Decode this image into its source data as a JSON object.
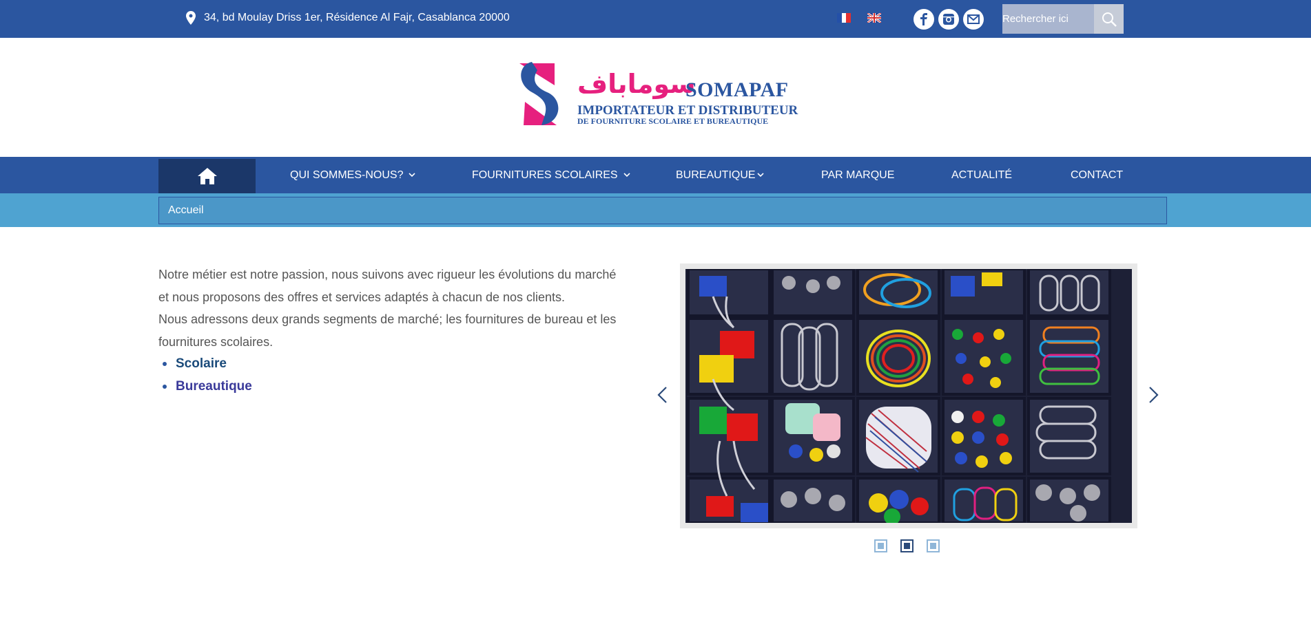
{
  "topbar": {
    "address": "34, bd Moulay Driss 1er, Résidence Al Fajr, Casablanca 20000",
    "search_placeholder": "Rechercher ici",
    "languages": [
      "fr",
      "en"
    ],
    "socials": [
      "facebook-icon",
      "instagram-icon",
      "email-icon"
    ],
    "bg_color": "#2b56a0"
  },
  "logo": {
    "arabic": "سوماباف",
    "brand": "SOMAPAF",
    "line1": "IMPORTATEUR ET DISTRIBUTEUR",
    "line2": "DE FOURNITURE SCOLAIRE ET BUREAUTIQUE",
    "colors": {
      "pink": "#e6207e",
      "blue": "#2b56a0"
    }
  },
  "nav": {
    "home_icon": "home-icon",
    "items": [
      {
        "label": "QUI SOMMES-NOUS?",
        "dropdown": true
      },
      {
        "label": "FOURNITURES SCOLAIRES",
        "dropdown": true
      },
      {
        "label": "BUREAUTIQUE",
        "dropdown": true
      },
      {
        "label": "PAR MARQUE",
        "dropdown": false
      },
      {
        "label": "ACTUALITÉ",
        "dropdown": false
      },
      {
        "label": "CONTACT",
        "dropdown": false
      }
    ]
  },
  "breadcrumb": {
    "current": "Accueil"
  },
  "content": {
    "intro_p1": "Notre métier est notre passion, nous suivons avec rigueur les évolutions du marché et nous proposons des offres et services adaptés à chacun de nos clients.",
    "intro_p2": "Nous adressons deux grands segments de marché; les fournitures de bureau et les fournitures scolaires.",
    "links": [
      {
        "label": "Scolaire",
        "color": "#1a4a7a"
      },
      {
        "label": "Bureautique",
        "color": "#3a3a9a"
      }
    ]
  },
  "slider": {
    "image_alt": "office-supplies-organizer",
    "total_slides": 3,
    "active_slide": 2
  }
}
